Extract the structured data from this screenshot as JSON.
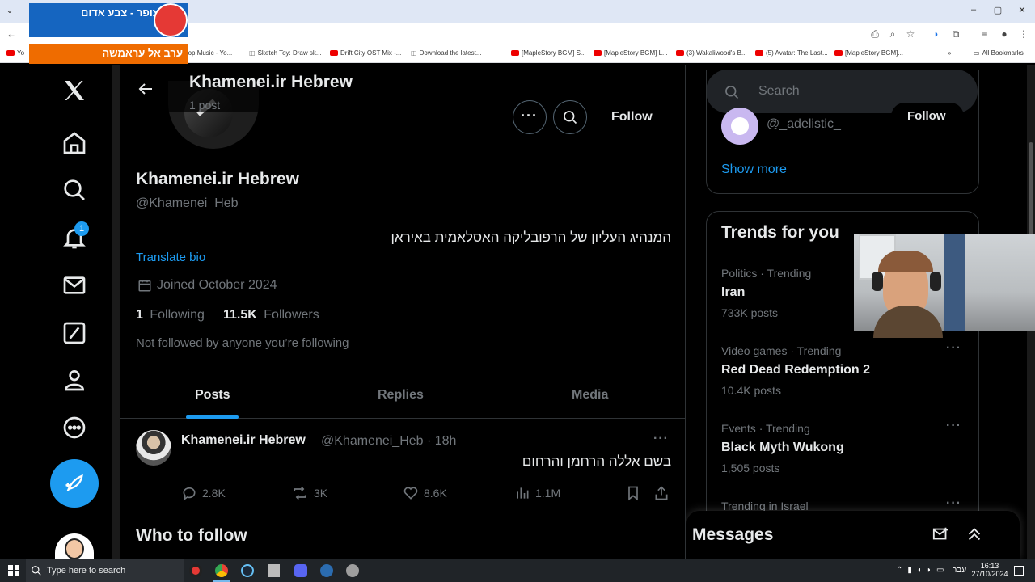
{
  "browser": {
    "bookmarks": [
      {
        "label": "Yo",
        "yt": true
      },
      {
        "label": "llhop Music - Yo...",
        "yt": false
      },
      {
        "label": "Sketch Toy: Draw sk...",
        "yt": false
      },
      {
        "label": "Drift City OST Mix -...",
        "yt": true
      },
      {
        "label": "Download the latest...",
        "yt": false
      },
      {
        "label": "[MapleStory BGM] S...",
        "yt": true
      },
      {
        "label": "[MapleStory BGM] L...",
        "yt": true
      },
      {
        "label": "(3) Wakaliwood's B...",
        "yt": true
      },
      {
        "label": "(5) Avatar: The Last...",
        "yt": true
      },
      {
        "label": "[MapleStory BGM]...",
        "yt": true
      }
    ],
    "all_bookmarks": "All Bookmarks"
  },
  "overlay": {
    "top_text": "צופר - צבע אדום",
    "bottom_text": "ערב אל עראמשה"
  },
  "nav": {
    "notification_count": "1"
  },
  "header": {
    "title": "Khamenei.ir Hebrew",
    "post_count": "1 post",
    "follow_label": "Follow",
    "more_icon": "more-icon",
    "search_icon": "search-icon"
  },
  "profile": {
    "name": "Khamenei.ir Hebrew",
    "handle": "@Khamenei_Heb",
    "bio": "המנהיג העליון של הרפובליקה האסלאמית באיראן",
    "translate": "Translate bio",
    "joined": "Joined October 2024",
    "following_count": "1",
    "following_label": "Following",
    "followers_count": "11.5K",
    "followers_label": "Followers",
    "not_followed": "Not followed by anyone you’re following"
  },
  "tabs": [
    {
      "label": "Posts",
      "active": true
    },
    {
      "label": "Replies",
      "active": false
    },
    {
      "label": "Media",
      "active": false
    }
  ],
  "post": {
    "author": "Khamenei.ir Hebrew",
    "handle_time": "@Khamenei_Heb · 18h",
    "text": "בשם אללה הרחמן והרחום",
    "replies": "2.8K",
    "reposts": "3K",
    "likes": "8.6K",
    "views": "1.1M"
  },
  "who_to_follow": "Who to follow",
  "sidebar": {
    "search_placeholder": "Search",
    "suggest_handle": "@_adelistic_",
    "suggest_follow": "Follow",
    "show_more": "Show more",
    "trends_title": "Trends for you",
    "trends": [
      {
        "category": "Politics · Trending",
        "name": "Iran",
        "count": "733K posts"
      },
      {
        "category": "Video games · Trending",
        "name": "Red Dead Redemption 2",
        "count": "10.4K posts"
      },
      {
        "category": "Events · Trending",
        "name": "Black Myth Wukong",
        "count": "1,505 posts"
      },
      {
        "category": "Trending in Israel",
        "name": "",
        "count": ""
      }
    ],
    "messages": "Messages"
  },
  "taskbar": {
    "search_placeholder": "Type here to search",
    "lang": "עבר",
    "time": "16:13",
    "date": "27/10/2024"
  },
  "colors": {
    "accent": "#1d9bf0",
    "bg": "#000000",
    "muted": "#71767b"
  }
}
